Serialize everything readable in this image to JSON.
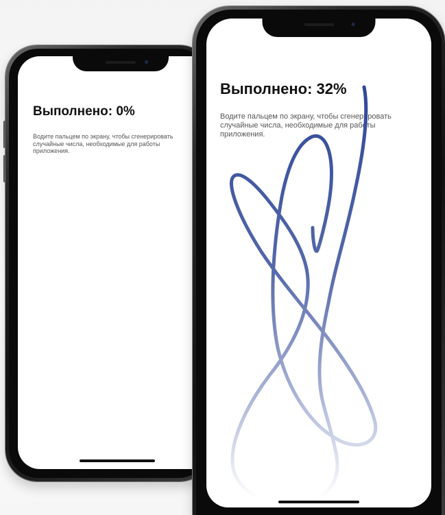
{
  "screens": {
    "back": {
      "title": "Выполнено: 0%",
      "instructions": "Водите пальцем по экрану, чтобы сгенерировать случайные числа, необходимые для работы приложения."
    },
    "front": {
      "title": "Выполнено: 32%",
      "instructions": "Водите пальцем по экрану, чтобы сгенерировать случайные числа, необходимые для работы приложения."
    }
  },
  "colors": {
    "stroke_start": "#2e4797",
    "stroke_end": "#ffffff",
    "title": "#111111",
    "instructions": "#555555"
  }
}
